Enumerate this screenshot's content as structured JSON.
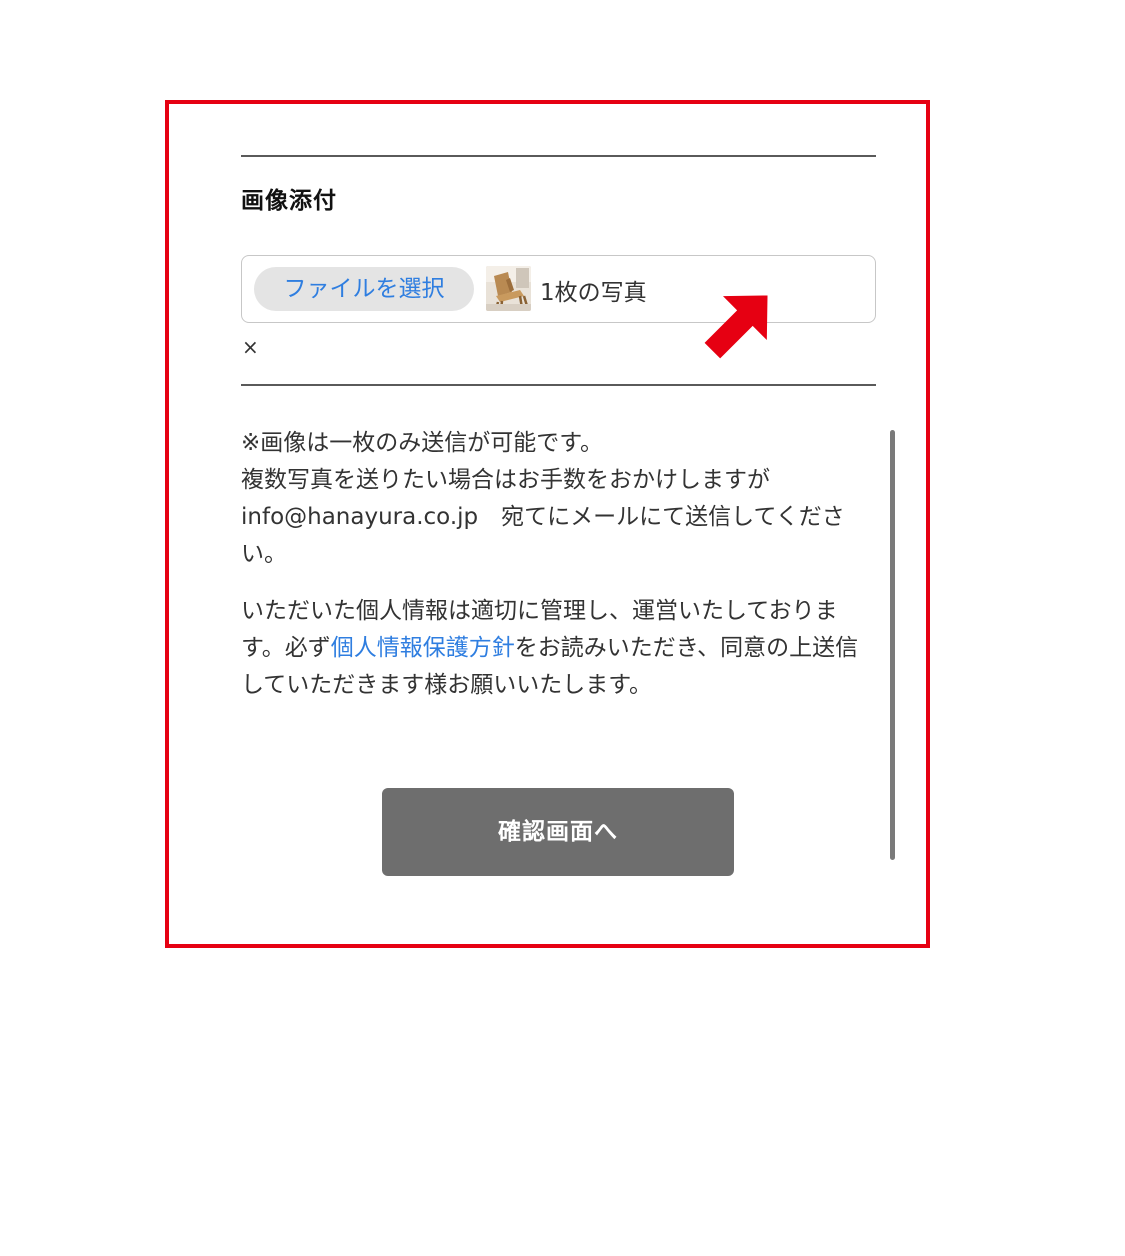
{
  "section": {
    "label": "画像添付"
  },
  "file_input": {
    "button_label": "ファイルを選択",
    "status": "1枚の写真",
    "thumbnail_icon": "chair-photo-thumbnail"
  },
  "clear_label": "×",
  "notes": {
    "line1": "※画像は一枚のみ送信が可能です。",
    "line2": "複数写真を送りたい場合はお手数をおかけしますが",
    "line3": "info@hanayura.co.jp　宛てにメールにて送信してください。",
    "privacy_before": "いただいた個人情報は適切に管理し、運営いたしております。必ず",
    "privacy_link": "個人情報保護方針",
    "privacy_after": "をお読みいただき、同意の上送信していただきます様お願いいたします。"
  },
  "confirm_button": {
    "label": "確認画面へ"
  },
  "colors": {
    "highlight": "#e60012",
    "link": "#2f7ee0",
    "button": "#6e6e6e"
  }
}
